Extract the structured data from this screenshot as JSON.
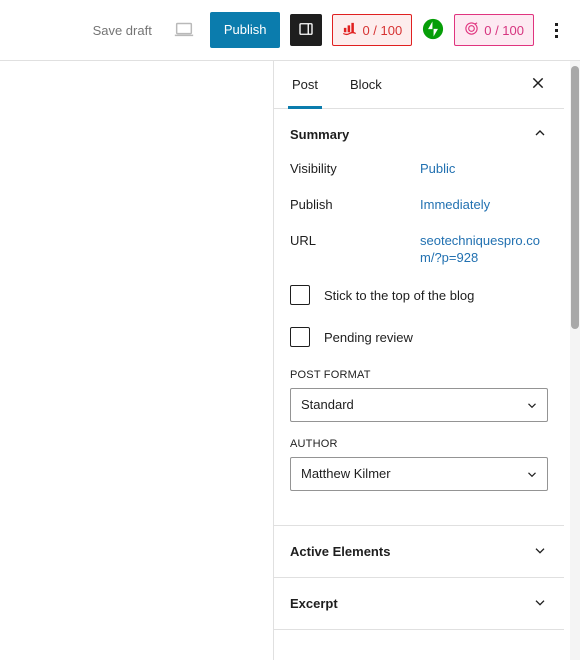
{
  "toolbar": {
    "save_draft_label": "Save draft",
    "preview_icon": "laptop-preview-icon",
    "publish_label": "Publish",
    "sidebar_toggle_icon": "sidebar-layout-icon",
    "seo_badge": {
      "icon": "readability-bars-icon",
      "score": "0 / 100",
      "border_color": "#e02020",
      "background_color": "#fdeded",
      "text_color": "#d63333"
    },
    "jetpack_icon": {
      "name": "jetpack-bolt-icon",
      "color": "#069e08"
    },
    "ai_badge": {
      "icon": "ai-target-icon",
      "score": "0 / 100",
      "border_color": "#e0347f",
      "background_color": "#fdeaf2",
      "text_color": "#d6347f"
    },
    "more_menu_icon": "three-dots-vertical-icon"
  },
  "sidebar": {
    "tabs": [
      {
        "label": "Post",
        "active": true
      },
      {
        "label": "Block",
        "active": false
      }
    ],
    "close_icon": "close-x-icon",
    "summary_panel": {
      "title": "Summary",
      "expanded": true,
      "chevron_icon": "chevron-up-icon",
      "rows": [
        {
          "label": "Visibility",
          "value": "Public"
        },
        {
          "label": "Publish",
          "value": "Immediately"
        },
        {
          "label": "URL",
          "value": "seotechniquespro.com/?p=928"
        }
      ],
      "checkboxes": [
        {
          "label": "Stick to the top of the blog",
          "checked": false
        },
        {
          "label": "Pending review",
          "checked": false
        }
      ],
      "fields": [
        {
          "label": "POST FORMAT",
          "value": "Standard",
          "chevron_icon": "chevron-down-icon"
        },
        {
          "label": "AUTHOR",
          "value": "Matthew Kilmer",
          "chevron_icon": "chevron-down-icon"
        }
      ]
    },
    "collapsed_panels": [
      {
        "title": "Active Elements",
        "chevron_icon": "chevron-down-icon"
      },
      {
        "title": "Excerpt",
        "chevron_icon": "chevron-down-icon"
      }
    ]
  },
  "colors": {
    "publish_blue": "#0b7cad",
    "link_blue": "#2271b1",
    "tab_underline": "#0b7cad"
  }
}
